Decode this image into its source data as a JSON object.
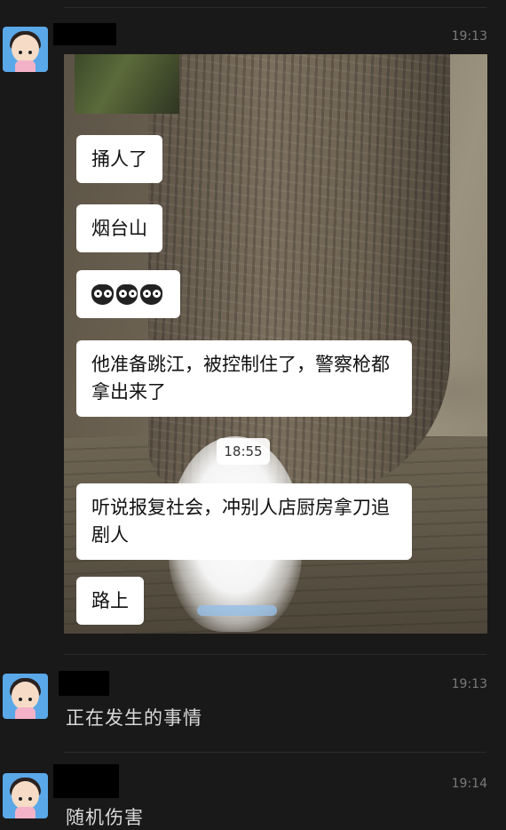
{
  "messages": [
    {
      "time": "19:13",
      "image": {
        "bubbles": [
          "捅人了",
          "烟台山",
          "",
          "他准备跳江，被控制住了，警察枪都拿出来了",
          "听说报复社会，冲别人店厨房拿刀追剧人",
          "路上"
        ],
        "emoji_icons": [
          "owl-emoji-icon",
          "owl-emoji-icon",
          "owl-emoji-icon"
        ],
        "timestamp": "18:55"
      }
    },
    {
      "time": "19:13",
      "text": "正在发生的事情"
    },
    {
      "time": "19:14",
      "text": "随机伤害"
    }
  ]
}
